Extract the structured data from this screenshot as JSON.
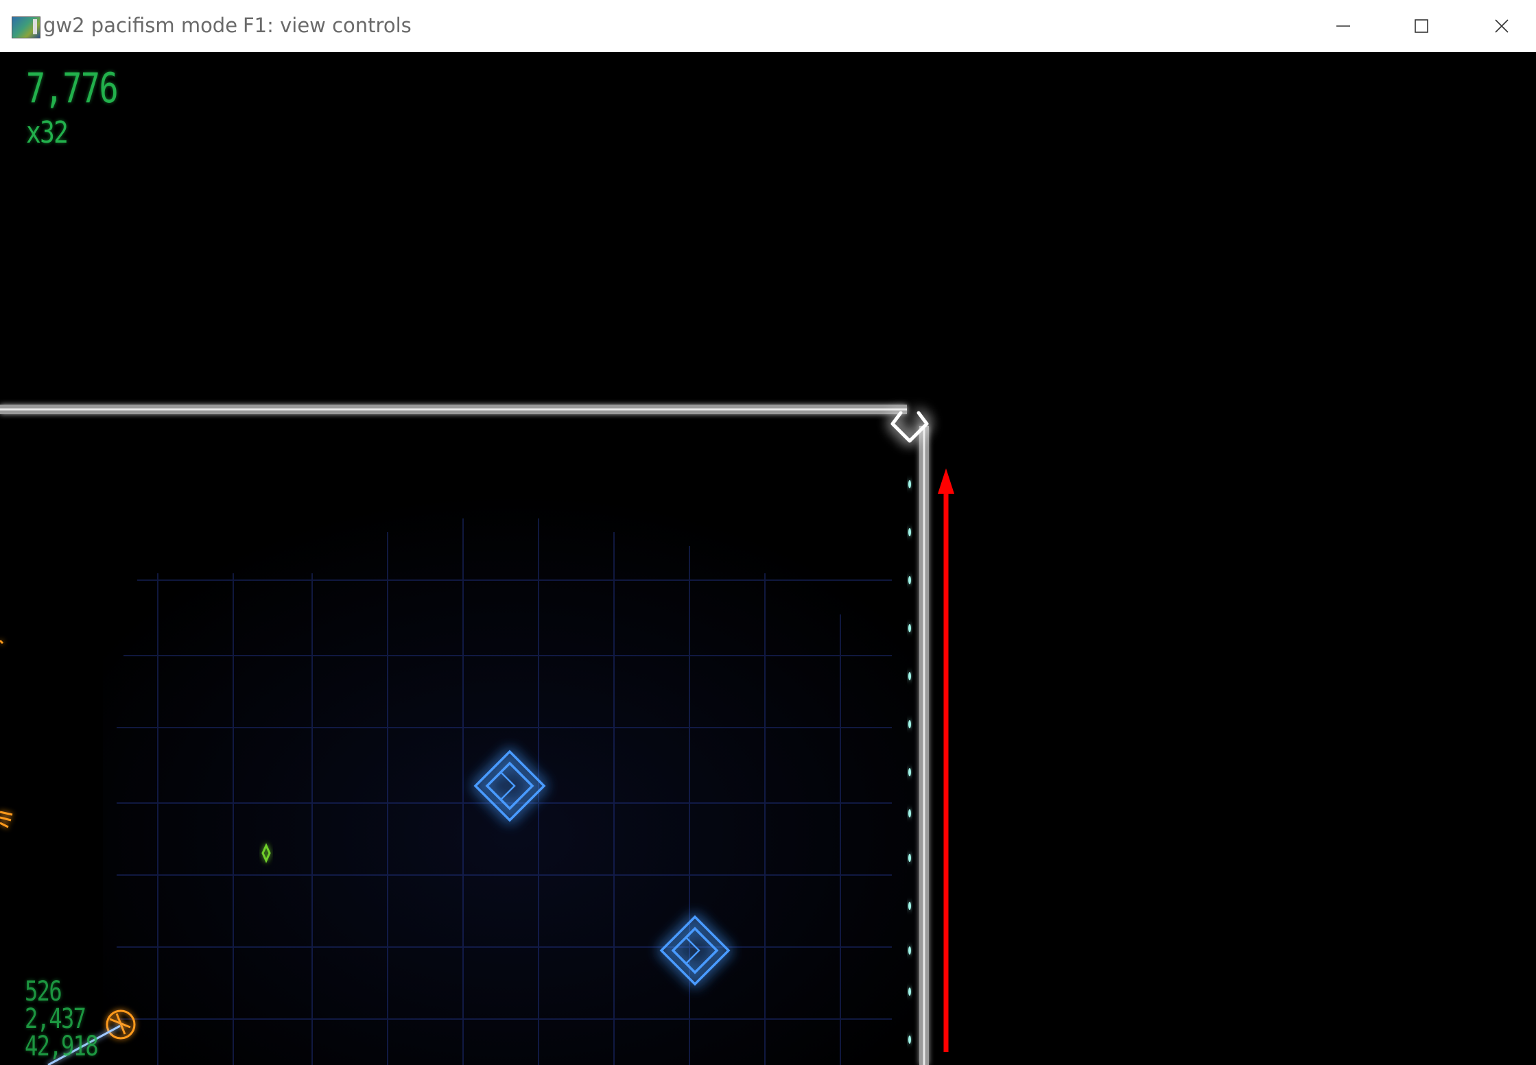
{
  "window": {
    "title": "gw2 pacifism mode",
    "hint": "F1: view controls",
    "icon": "app-icon",
    "controls": [
      "minimize-icon",
      "maximize-icon",
      "close-icon"
    ]
  },
  "hud": {
    "score": "7,776",
    "multiplier": "x32",
    "stats": [
      "526",
      "2,437",
      "42,918"
    ],
    "color": "#22b14c"
  },
  "colors": {
    "background": "#000000",
    "grid": "#1a2a6a",
    "wall": "#b8b8b8",
    "ship": "#ffffff",
    "enemy_diamond": "#3a8cff",
    "annotation_arrow": "#ff0000",
    "orange_enemy": "#ff9a1a",
    "green_geom": "#6fd02a"
  },
  "entities": {
    "player": "player-ship-icon",
    "enemies": [
      "blue-diamond-enemy-icon",
      "blue-diamond-enemy-icon"
    ],
    "annotation": "red-up-arrow-icon"
  }
}
